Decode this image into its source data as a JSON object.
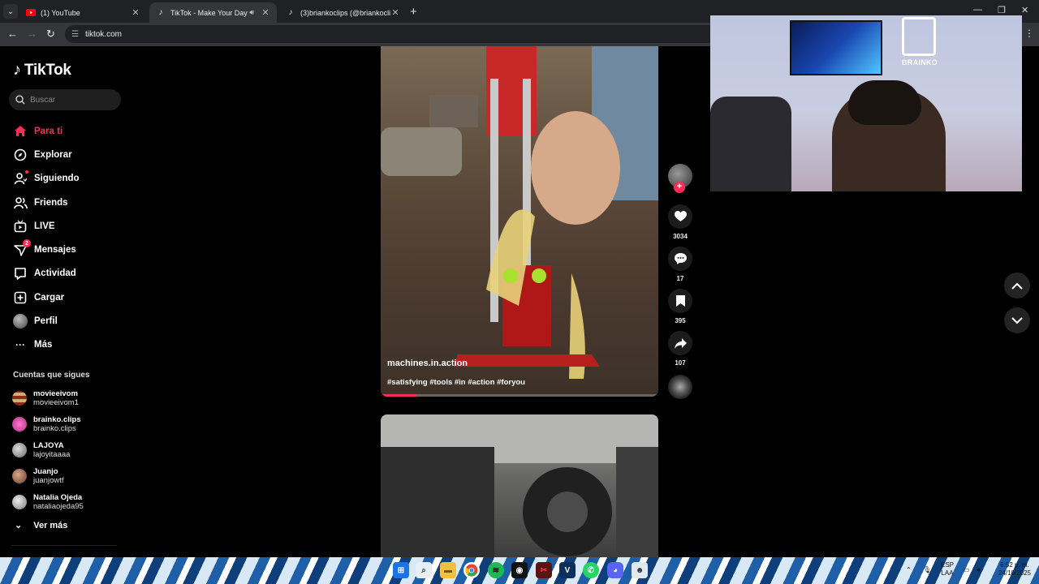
{
  "browser": {
    "tabs": [
      {
        "title": "(1) YouTube",
        "active": false
      },
      {
        "title": "TikTok - Make Your Day",
        "active": true
      },
      {
        "title": "(3)briankoclips (@briankoclips)",
        "active": false
      }
    ],
    "url": "tiktok.com"
  },
  "sidebar": {
    "logo": "TikTok",
    "search_placeholder": "Buscar",
    "nav": [
      {
        "label": "Para ti",
        "icon": "home-icon",
        "active": true
      },
      {
        "label": "Explorar",
        "icon": "compass-icon"
      },
      {
        "label": "Siguiendo",
        "icon": "following-icon"
      },
      {
        "label": "Friends",
        "icon": "friends-icon"
      },
      {
        "label": "LIVE",
        "icon": "live-icon"
      },
      {
        "label": "Mensajes",
        "icon": "messages-icon",
        "badge": "2"
      },
      {
        "label": "Actividad",
        "icon": "activity-icon"
      },
      {
        "label": "Cargar",
        "icon": "upload-icon"
      },
      {
        "label": "Perfil",
        "icon": "profile-avatar"
      },
      {
        "label": "Más",
        "icon": "more-icon"
      }
    ],
    "following_title": "Cuentas que sigues",
    "following": [
      {
        "name": "movieeivom",
        "username": "movieeivom1"
      },
      {
        "name": "brainko.clips",
        "username": "brainko.clips"
      },
      {
        "name": "LAJOYA",
        "username": "lajoyitaaaa"
      },
      {
        "name": "Juanjo",
        "username": "juanjowtf"
      },
      {
        "name": "Natalia Ojeda",
        "username": "nataliaojeda95"
      }
    ],
    "see_more": "Ver más"
  },
  "video": {
    "author": "machines.in.action",
    "caption": "#satisfying #tools #in #action #foryou",
    "progress": 0.13,
    "likes": "3034",
    "comments": "17",
    "saves": "395",
    "shares": "107"
  },
  "stream_overlay": {
    "brand": "BRAINKO"
  },
  "taskbar": {
    "language": "ESP",
    "layout": "LAA",
    "time": "6:52 p. m.",
    "date": "24/10/2025"
  }
}
